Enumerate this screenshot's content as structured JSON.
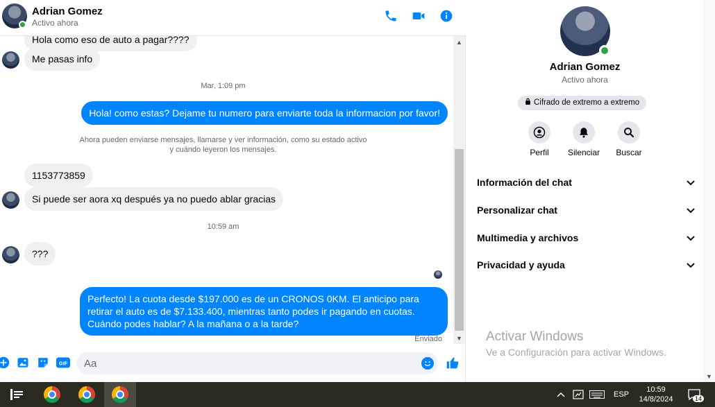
{
  "header": {
    "name": "Adrian Gomez",
    "status": "Activo ahora"
  },
  "messages": {
    "partial_top": "Hola como eso de auto a pagar????",
    "in_1": "Me pasas info",
    "time_1": "Mar, 1:09 pm",
    "out_1": "Hola! como estas? Dejame tu numero para enviarte toda la informacion por favor!",
    "system_note_line1": "Ahora pueden enviarse mensajes, llamarse y ver información, como su estado activo",
    "system_note_line2": "y cuándo leyeron los mensajes.",
    "in_2": "1153773859",
    "in_3": "Si puede ser aora xq después ya no puedo ablar gracias",
    "time_2": "10:59 am",
    "in_4": "???",
    "out_2": "Perfecto! La cuota desde $197.000 es de un CRONOS 0KM. El anticipo para retirar el auto es de $7.133.400, mientras tanto podes ir pagando en cuotas. Cuándo podes hablar? A la mañana o a la tarde?",
    "sent_status": "Enviado"
  },
  "composer": {
    "placeholder": "Aa"
  },
  "info": {
    "name": "Adrian Gomez",
    "status": "Activo ahora",
    "e2e_label": "Cifrado de extremo a extremo",
    "actions": [
      {
        "label": "Perfil",
        "icon": "profile-icon"
      },
      {
        "label": "Silenciar",
        "icon": "bell-icon"
      },
      {
        "label": "Buscar",
        "icon": "search-icon"
      }
    ],
    "sections": [
      "Información del chat",
      "Personalizar chat",
      "Multimedia y archivos",
      "Privacidad y ayuda"
    ]
  },
  "watermark": {
    "title": "Activar Windows",
    "subtitle": "Ve a Configuración para activar Windows."
  },
  "taskbar": {
    "language": "ESP",
    "time": "10:59",
    "date": "14/8/2024",
    "notification_count": "14"
  },
  "colors": {
    "accent": "#0084ff",
    "incoming_bubble": "#f0f0f0",
    "online": "#31a24c",
    "taskbar": "#2b2b22"
  }
}
